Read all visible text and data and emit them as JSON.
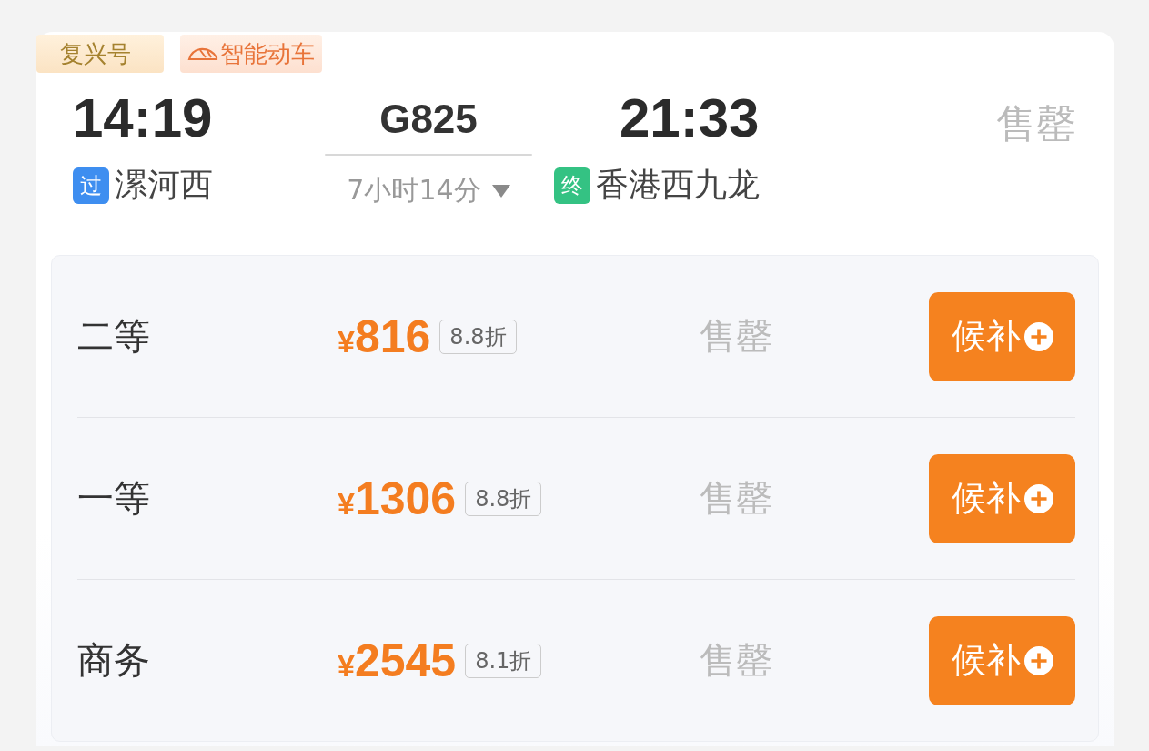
{
  "train": {
    "tags": [
      {
        "kind": "brand",
        "label": "复兴号"
      },
      {
        "kind": "smart",
        "label": "智能动车"
      }
    ],
    "departure": {
      "time": "14:19",
      "badge": {
        "text": "过",
        "color": "#3e8ef0"
      },
      "station": "漯河西"
    },
    "number": "G825",
    "duration": "7小时14分",
    "duration_expanded": false,
    "arrival": {
      "time": "21:33",
      "badge": {
        "text": "终",
        "color": "#34c283"
      },
      "station": "香港西九龙"
    },
    "status": "售罄"
  },
  "seats": [
    {
      "class": "二等",
      "currency": "¥",
      "price": "816",
      "discount": "8.8折",
      "status": "售罄",
      "button": "候补"
    },
    {
      "class": "一等",
      "currency": "¥",
      "price": "1306",
      "discount": "8.8折",
      "status": "售罄",
      "button": "候补"
    },
    {
      "class": "商务",
      "currency": "¥",
      "price": "2545",
      "discount": "8.1折",
      "status": "售罄",
      "button": "候补"
    }
  ]
}
